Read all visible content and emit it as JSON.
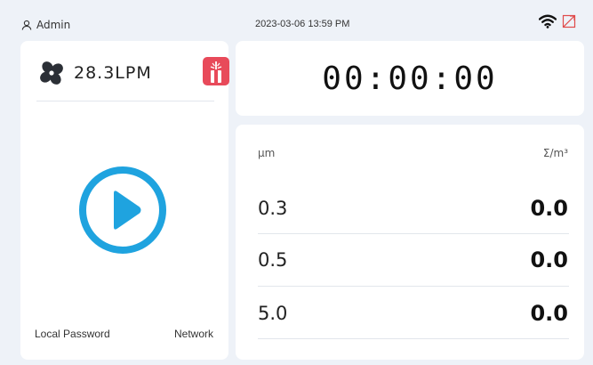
{
  "status_bar": {
    "user_name": "Admin",
    "datetime": "2023-03-06 13:59 PM",
    "icons": [
      "user-icon",
      "wifi-icon",
      "no-signal-icon"
    ]
  },
  "left_panel": {
    "flow_value": "28.3LPM",
    "icons": [
      "fan-icon",
      "laser-icon",
      "play-icon"
    ],
    "local_password_label": "Local Password",
    "network_label": "Network"
  },
  "timer": {
    "value": "00:00:00"
  },
  "particle_table": {
    "size_header": "μm",
    "count_header": "Σ/m³",
    "rows": [
      {
        "size": "0.3",
        "count": "0.0"
      },
      {
        "size": "0.5",
        "count": "0.0"
      },
      {
        "size": "5.0",
        "count": "0.0"
      }
    ]
  },
  "colors": {
    "background": "#eef2f8",
    "accent_blue": "#1fa3df",
    "laser_red": "#e84a5a",
    "signal_red": "#e04a4a"
  }
}
